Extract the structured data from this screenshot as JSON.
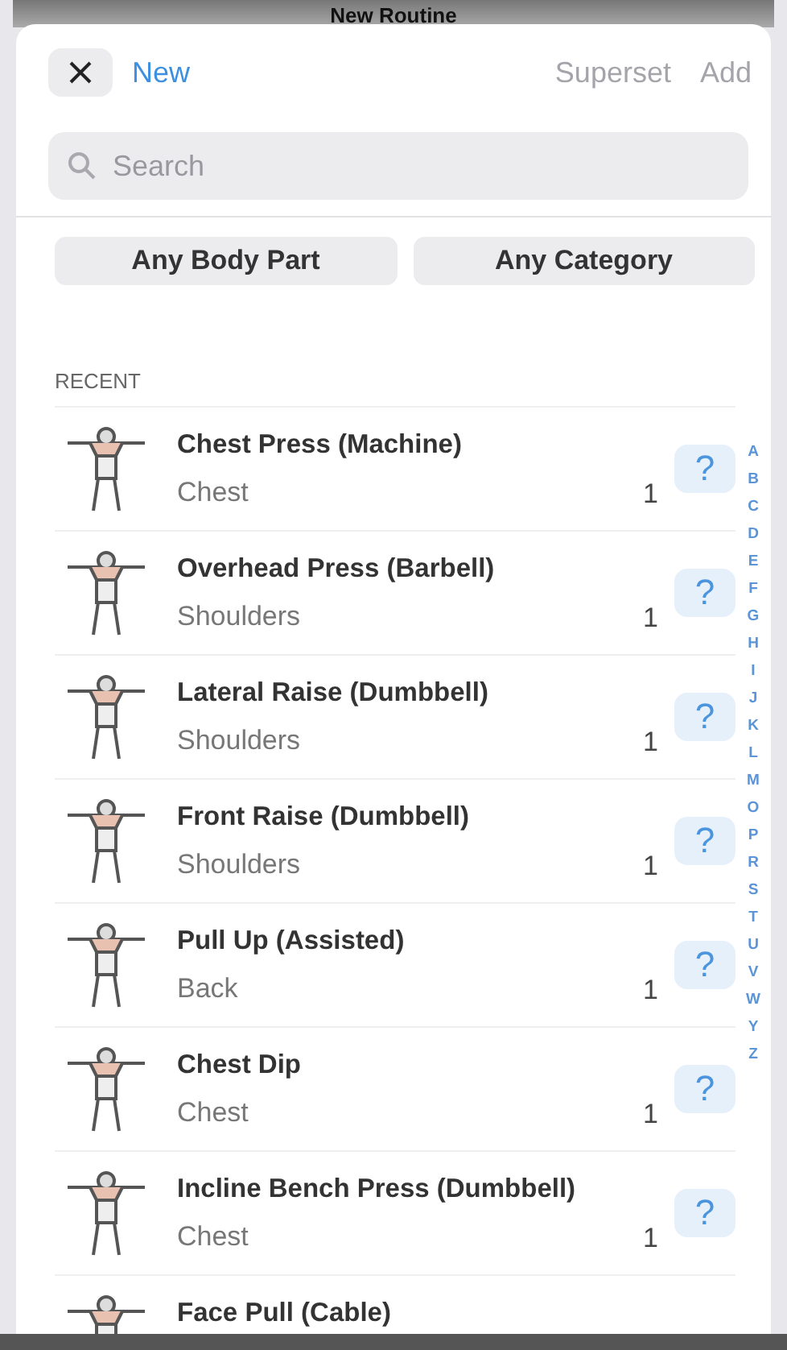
{
  "background_title": "New Routine",
  "header": {
    "new_label": "New",
    "actions": [
      {
        "label": "Superset",
        "disabled": true
      },
      {
        "label": "Add",
        "disabled": true
      }
    ]
  },
  "search": {
    "placeholder": "Search"
  },
  "filters": [
    "Any Body Part",
    "Any Category"
  ],
  "section_title": "RECENT",
  "exercises": [
    {
      "name": "Chest Press (Machine)",
      "category": "Chest",
      "count": "1"
    },
    {
      "name": "Overhead Press (Barbell)",
      "category": "Shoulders",
      "count": "1"
    },
    {
      "name": "Lateral Raise (Dumbbell)",
      "category": "Shoulders",
      "count": "1"
    },
    {
      "name": "Front Raise (Dumbbell)",
      "category": "Shoulders",
      "count": "1"
    },
    {
      "name": "Pull Up (Assisted)",
      "category": "Back",
      "count": "1"
    },
    {
      "name": "Chest Dip",
      "category": "Chest",
      "count": "1"
    },
    {
      "name": "Incline Bench Press (Dumbbell)",
      "category": "Chest",
      "count": "1"
    },
    {
      "name": "Face Pull (Cable)"
    }
  ],
  "help_label": "?",
  "index_letters": [
    "A",
    "B",
    "C",
    "D",
    "E",
    "F",
    "G",
    "H",
    "I",
    "J",
    "K",
    "L",
    "M",
    "O",
    "P",
    "R",
    "S",
    "T",
    "U",
    "V",
    "W",
    "Y",
    "Z"
  ]
}
